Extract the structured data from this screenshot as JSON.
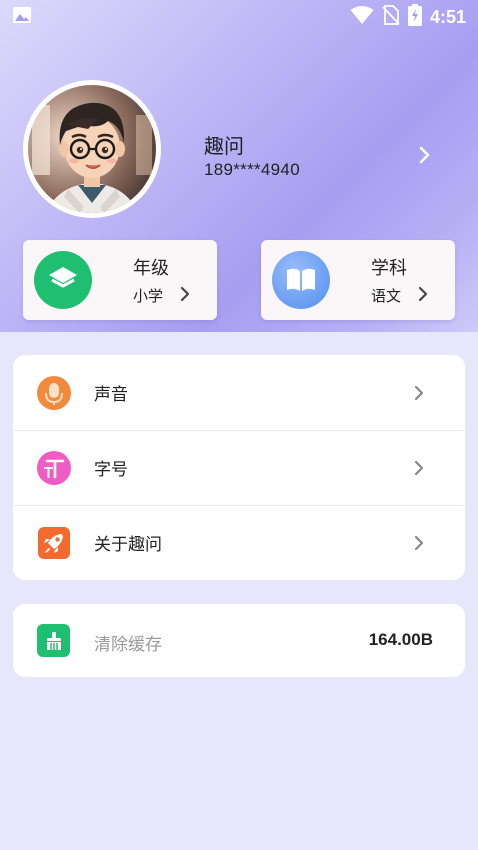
{
  "status_bar": {
    "time": "4:51",
    "icons": [
      "image-icon",
      "wifi-icon",
      "no-sim-icon",
      "battery-charging-icon"
    ]
  },
  "profile": {
    "name": "趣问",
    "phone": "189****4940",
    "avatar": "avatar-illustration"
  },
  "quick_cards": [
    {
      "title": "年级",
      "value": "小学",
      "icon": "layers-icon",
      "color": "#1fbf72"
    },
    {
      "title": "学科",
      "value": "语文",
      "icon": "book-icon",
      "color": "#4f8ef0"
    }
  ],
  "settings": [
    {
      "label": "声音",
      "icon": "microphone-icon",
      "color": "#f3893a"
    },
    {
      "label": "字号",
      "icon": "font-size-icon",
      "color": "#ee5cc4"
    },
    {
      "label": "关于趣问",
      "icon": "rocket-icon",
      "color": "#f36a2e"
    }
  ],
  "cache": {
    "label": "清除缓存",
    "size": "164.00B",
    "icon": "broom-icon"
  }
}
